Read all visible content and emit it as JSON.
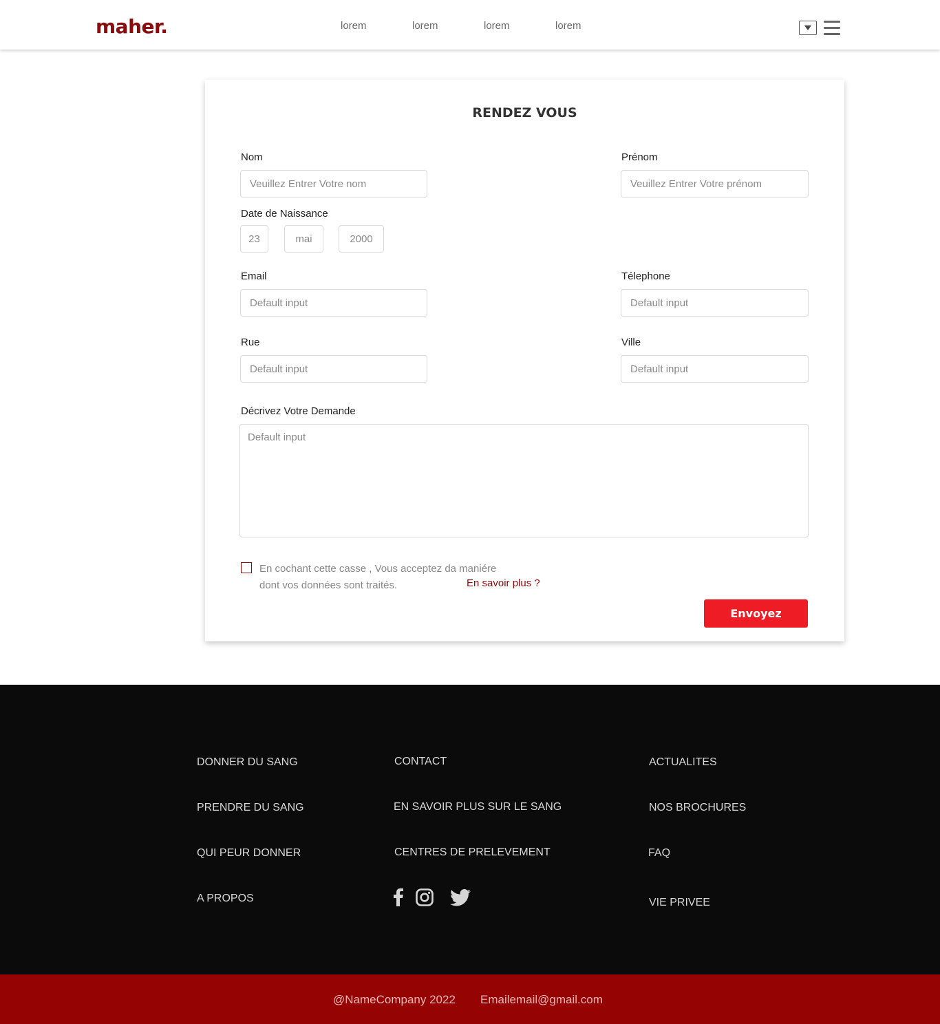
{
  "header": {
    "logo": "maher.",
    "nav": [
      "lorem",
      "lorem",
      "lorem",
      "lorem"
    ]
  },
  "form": {
    "title": "RENDEZ VOUS",
    "nom": {
      "label": "Nom",
      "placeholder": "Veuillez Entrer Votre nom"
    },
    "prenom": {
      "label": "Prénom",
      "placeholder": "Veuillez Entrer Votre prénom"
    },
    "birth": {
      "label": "Date de Naissance",
      "day": "23",
      "month": "mai",
      "year": "2000"
    },
    "email": {
      "label": "Email",
      "placeholder": "Default input"
    },
    "telephone": {
      "label": "Télephone",
      "placeholder": "Default input"
    },
    "rue": {
      "label": "Rue",
      "placeholder": "Default input"
    },
    "ville": {
      "label": "Ville",
      "placeholder": "Default input"
    },
    "demande": {
      "label": "Décrivez Votre Demande",
      "placeholder": "Default input"
    },
    "consent_line1": "En cochant cette casse , Vous acceptez da maniére",
    "consent_line2": "dont vos données sont traités.",
    "more": "En savoir plus ?",
    "submit": "Envoyez"
  },
  "footer": {
    "col1": [
      "DONNER DU SANG",
      "PRENDRE DU SANG",
      "QUI PEUR DONNER",
      "A PROPOS"
    ],
    "col2": [
      "CONTACT",
      "EN SAVOIR PLUS SUR LE SANG",
      "CENTRES DE PRELEVEMENT"
    ],
    "col3": [
      "ACTUALITES",
      "NOS BROCHURES",
      "FAQ",
      "VIE PRIVEE"
    ],
    "social": [
      "facebook-icon",
      "instagram-icon",
      "twitter-icon"
    ],
    "copyright": "@NameCompany 2022",
    "email": "Emailemail@gmail.com"
  },
  "colors": {
    "brand": "#8b0c0c",
    "accent": "#ee1c25",
    "footer_bg": "#0b0b0c",
    "bottom_bar": "#960303"
  }
}
